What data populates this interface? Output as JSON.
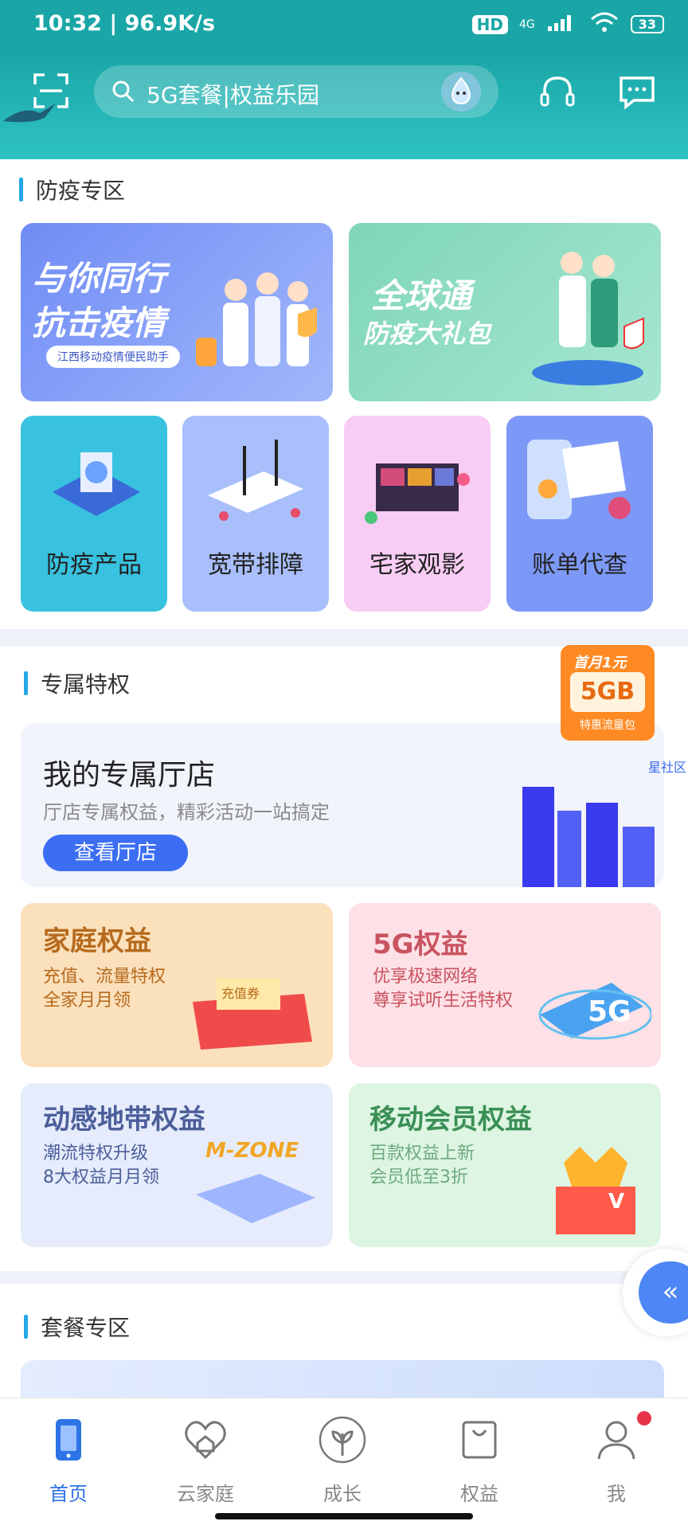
{
  "status": {
    "time": "10:32 | 96.9K/s",
    "hd": "HD",
    "network": "4G",
    "battery": "33"
  },
  "search": {
    "placeholder": "5G套餐|权益乐园"
  },
  "sections": {
    "epidemic": {
      "title": "防疫专区",
      "banner1": {
        "line1": "与你同行",
        "line2": "抗击疫情",
        "tag": "江西移动疫情便民助手"
      },
      "banner2": {
        "line1": "全球通",
        "line2": "防疫大礼包"
      },
      "tiles": [
        {
          "label": "防疫产品",
          "bg": "#38c2df"
        },
        {
          "label": "宽带排障",
          "bg": "#a8bffb"
        },
        {
          "label": "宅家观影",
          "bg": "#f8cdf3"
        },
        {
          "label": "账单代查",
          "bg": "#7d99f7"
        }
      ]
    },
    "exclusive": {
      "title": "专属特权",
      "store": {
        "title": "我的专属厅店",
        "subtitle": "厅店专属权益，精彩活动一站搞定",
        "button": "查看厅店",
        "badge_top": "首月1元",
        "badge_main": "5GB",
        "badge_sub": "特惠流量包",
        "side_text": "星社区"
      },
      "cards": [
        {
          "title": "家庭权益",
          "line1": "充值、流量特权",
          "line2": "全家月月领",
          "extra": "充值券",
          "bg": "#fbe0bc",
          "title_color": "#b66a1c"
        },
        {
          "title": "5G权益",
          "line1": "优享极速网络",
          "line2": "尊享试听生活特权",
          "extra": "5G",
          "bg": "#fde1e6",
          "title_color": "#c95360"
        },
        {
          "title": "动感地带权益",
          "line1": "潮流特权升级",
          "line2": "8大权益月月领",
          "extra": "M-ZONE",
          "bg": "#e6ecfb",
          "title_color": "#4b5e9a"
        },
        {
          "title": "移动会员权益",
          "line1": "百款权益上新",
          "line2": "会员低至3折",
          "extra": "V",
          "bg": "#ddf5e2",
          "title_color": "#3a8f55"
        }
      ]
    },
    "package": {
      "title": "套餐专区"
    }
  },
  "float_button": "«",
  "nav": [
    {
      "label": "首页",
      "icon": "phone-icon",
      "active": true
    },
    {
      "label": "云家庭",
      "icon": "heart-home-icon",
      "active": false
    },
    {
      "label": "成长",
      "icon": "sprout-icon",
      "active": false
    },
    {
      "label": "权益",
      "icon": "bag-icon",
      "active": false
    },
    {
      "label": "我",
      "icon": "user-icon",
      "active": false
    }
  ],
  "colors": {
    "brand": "#1aa6a6",
    "accent": "#3b6ef3",
    "nav_active": "#2d74e6"
  }
}
